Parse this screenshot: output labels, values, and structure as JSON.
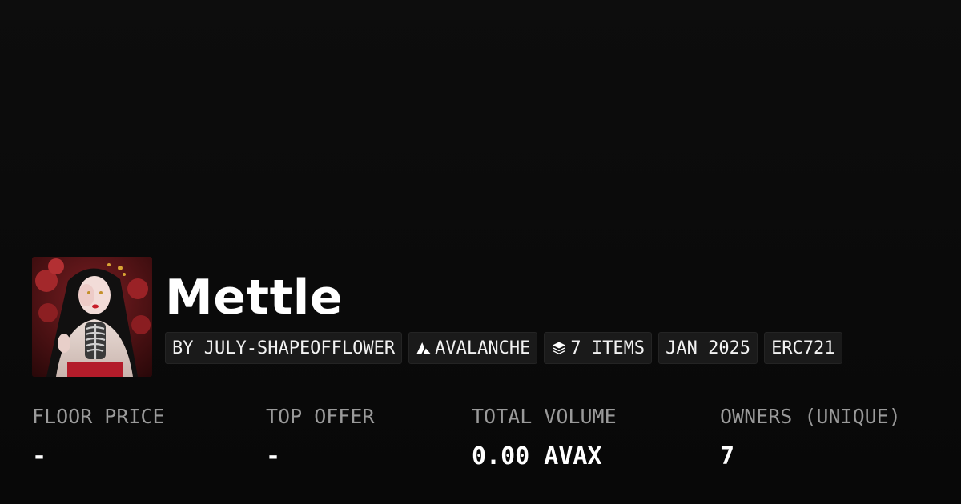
{
  "collection": {
    "name": "Mettle",
    "thumbnail_icon": "collection-artwork"
  },
  "tags": {
    "creator": "BY JULY-SHAPEOFFLOWER",
    "chain": "AVALANCHE",
    "chain_icon": "avalanche-logo-icon",
    "items": "7 ITEMS",
    "items_icon": "layers-icon",
    "date": "JAN 2025",
    "standard": "ERC721"
  },
  "stats": [
    {
      "label": "FLOOR PRICE",
      "value": "-"
    },
    {
      "label": "TOP OFFER",
      "value": "-"
    },
    {
      "label": "TOTAL VOLUME",
      "value": "0.00 AVAX"
    },
    {
      "label": "OWNERS (UNIQUE)",
      "value": "7"
    }
  ],
  "colors": {
    "background": "#0b0b0b",
    "tag_background": "#1a1a1a",
    "label": "#9a9a9a",
    "text": "#ffffff"
  }
}
